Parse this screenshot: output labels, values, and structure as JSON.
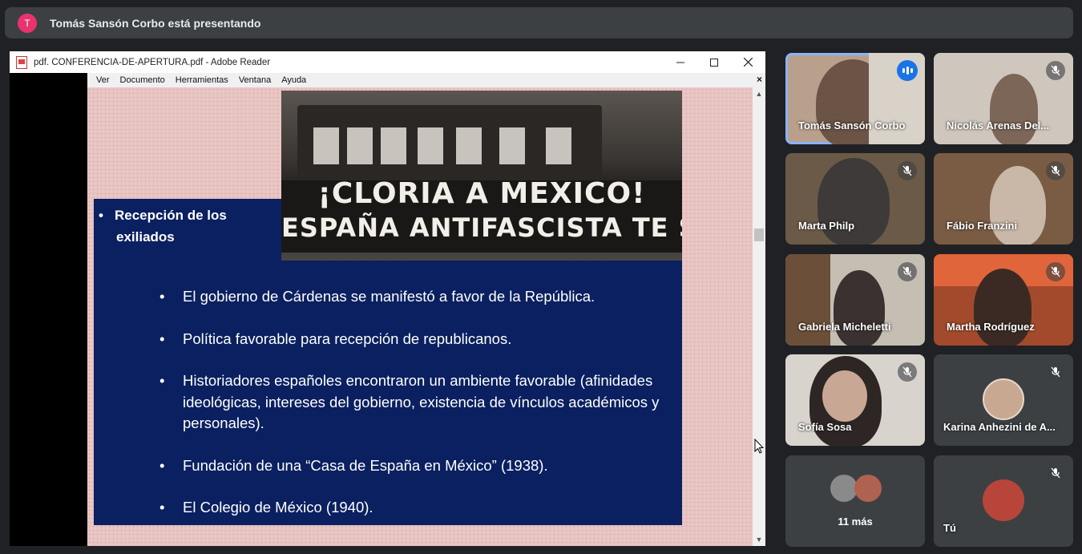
{
  "banner": {
    "initial": "T",
    "text": "Tomás Sansón Corbo está presentando"
  },
  "reader": {
    "title": "pdf. CONFERENCIA-DE-APERTURA.pdf - Adobe Reader",
    "menu": [
      "Ver",
      "Documento",
      "Herramientas",
      "Ventana",
      "Ayuda"
    ],
    "close_symbol": "×"
  },
  "slide": {
    "photo_sign_line1": "¡CLORIA A MEXICO!",
    "photo_sign_line2": "ESPAÑA ANTIFASCISTA TE SALUDA",
    "heading_line1": "Recepción de los",
    "heading_line2": "exiliados",
    "bullets": [
      "El gobierno de Cárdenas se manifestó a favor de la República.",
      "Política favorable para recepción de republicanos.",
      "Historiadores españoles encontraron un ambiente favorable (afinidades ideológicas, intereses del gobierno, existencia de vínculos académicos y personales).",
      "Fundación de una “Casa de España en México” (1938).",
      "El Colegio de México (1940)."
    ]
  },
  "participants": [
    {
      "name": "Tomás Sansón Corbo"
    },
    {
      "name": "Nicolás Arenas Del..."
    },
    {
      "name": "Marta Philp"
    },
    {
      "name": "Fábio Franzini"
    },
    {
      "name": "Gabriela Micheletti"
    },
    {
      "name": "Martha Rodríguez"
    },
    {
      "name": "Sofía Sosa"
    },
    {
      "name": "Karina Anhezini de A..."
    },
    {
      "name": "11 más"
    },
    {
      "name": "Tú"
    }
  ]
}
